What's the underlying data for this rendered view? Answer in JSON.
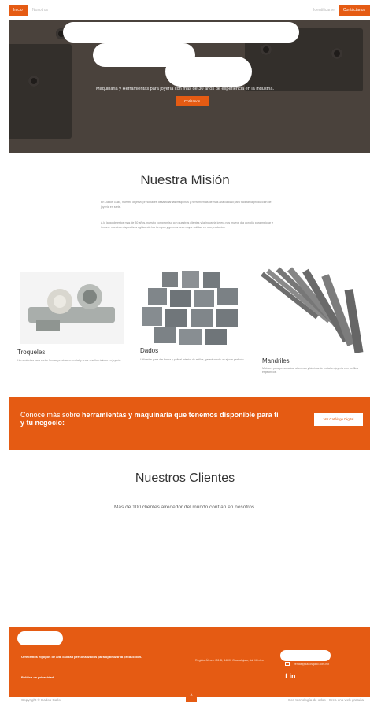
{
  "nav": {
    "home_label": "Inicio",
    "about_label": "Nosotros",
    "login_label": "Identificarse",
    "contact_label": "Contáctanos"
  },
  "hero": {
    "subtitle": "Maquinaria y Herramientas para joyería con más de 30 años de experiencia en la industria.",
    "button_label": "Cotízanos"
  },
  "mision": {
    "title": "Nuestra Misión",
    "paragraph1": "En Dados Gallo, nuestro objetivo principal es desarrollar las máquinas y herramientas de más alta calidad para facilitar la producción de joyería en serie.",
    "paragraph2": "A lo largo de estos más de 30 años, nuestro compromiso con nuestros clientes y la industria joyera nos mueve día con día para mejorar e innovar nuestros dispositivos agilizando los tiempos y generar una mayor calidad en sus productos."
  },
  "products": [
    {
      "title": "Troqueles",
      "description": "Herramientas para cortar formas precisas en metal y crear diseños únicos en joyería."
    },
    {
      "title": "Dados",
      "description": "Utilizados para dar forma y pulir el interior de anillos, garantizando un ajuste perfecto."
    },
    {
      "title": "Mandriles",
      "description": "Matrices para personalizar alambres y láminas de metal en joyería con perfiles específicos."
    }
  ],
  "cta": {
    "text_plain": "Conoce más sobre ",
    "text_bold": "herramientas y maquinaria que tenemos disponible para ti y tu negocio:",
    "button_label": "Ver Catálogo Digital"
  },
  "clientes": {
    "title": "Nuestros Clientes",
    "subtitle": "Más de 100 clientes alrededor del mundo confían en nosotros."
  },
  "footer": {
    "tagline": "Ofrecemos equipos de alta calidad personalizados para optimizar la producción.",
    "privacy_label": "Política de privacidad",
    "address": "Regidor Álvaro 451 B, 44200 Guadalajara, Jal. México",
    "email": "ventas@dadosgallo.com.mx",
    "social": "f  in"
  },
  "bottom": {
    "copyright": "Copyright © Dados Gallo",
    "powered": "Con tecnología de odoo - Crea una web gratuita",
    "scroll_top": "^"
  },
  "colors": {
    "brand": "#e55b13",
    "text": "#333333",
    "muted": "#8a8a8a"
  }
}
